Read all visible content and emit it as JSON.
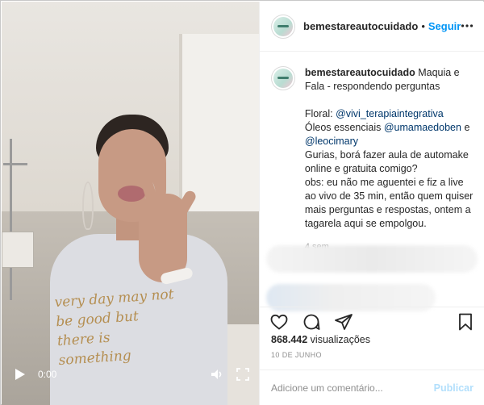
{
  "video": {
    "time": "0:00",
    "shirt_text": "very day may not be good but there is something"
  },
  "post": {
    "username": "bemestareautocuidado",
    "separator": "•",
    "follow_label": "Seguir",
    "caption_title": "Maquia e Fala - respondendo perguntas",
    "floral_label": "Floral:",
    "floral_handle": "@vivi_terapiaintegrativa",
    "oleos_label": "Óleos essenciais",
    "oleos_handle1": "@umamaedoben",
    "oleos_and": "e",
    "oleos_handle2": "@leocimary",
    "invite": "Gurias, borá fazer aula de automake online e gratuita comigo?",
    "obs": "obs: eu não me aguentei e fiz a live ao vivo de 35 min, então quem quiser mais perguntas e respostas, ontem a tagarela aqui se empolgou.",
    "time_ago": "4 sem",
    "views_count": "868.442",
    "views_label": "visualizações",
    "date": "10 DE JUNHO",
    "comment_placeholder": "Adicione um comentário...",
    "publish_label": "Publicar"
  },
  "icons": {
    "play": "play-icon",
    "volume": "volume-icon",
    "fullscreen": "fullscreen-icon",
    "more": "more-options-icon",
    "like": "heart-icon",
    "comment": "comment-icon",
    "share": "share-icon",
    "save": "bookmark-icon"
  },
  "colors": {
    "link": "#00376b",
    "follow": "#0095f6",
    "publish_disabled": "#b2dffc",
    "muted": "#8e8e8e"
  }
}
